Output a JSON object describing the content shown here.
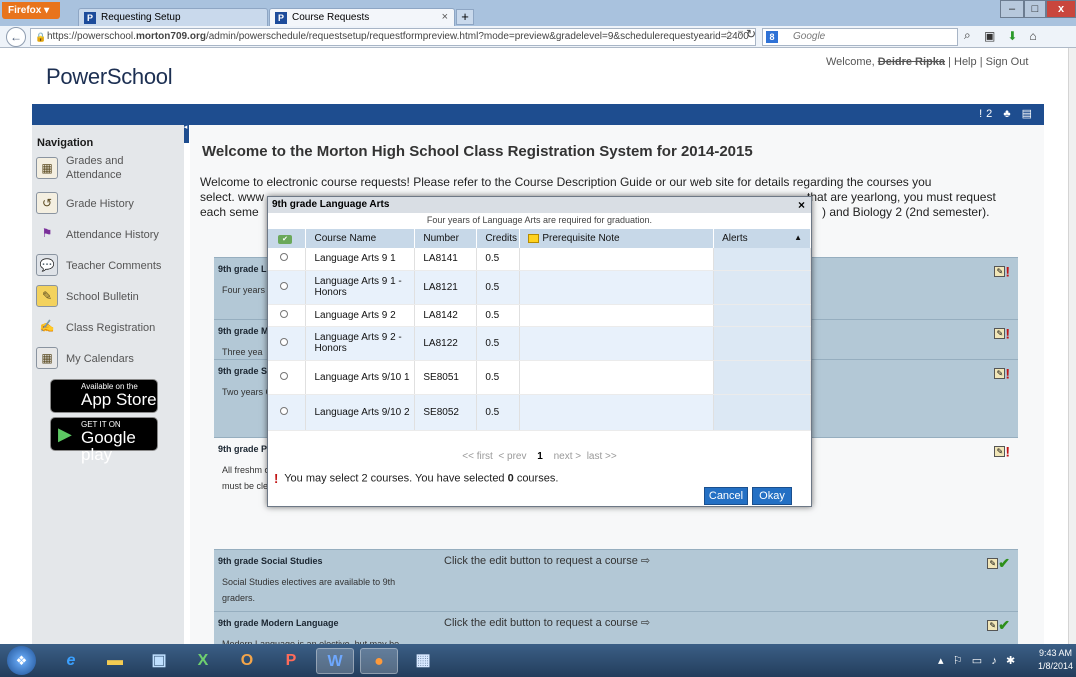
{
  "browser": {
    "menu_button": "Firefox",
    "tabs": [
      {
        "label": "Requesting Setup",
        "active": false
      },
      {
        "label": "Course Requests",
        "active": true
      }
    ],
    "url_prefix": "https://powerschool.",
    "url_domain": "morton709.org",
    "url_path": "/admin/powerschedule/requestsetup/requestformpreview.html?mode=preview&gradelevel=9&schedulerequestyearid=2400",
    "search_placeholder": "Google",
    "new_tab": "+"
  },
  "header": {
    "logo": "PowerSchool",
    "welcome": "Welcome,",
    "user_name": "Deidre Ripka",
    "sep": "|",
    "help": "Help",
    "sign_out": "Sign Out",
    "bar_count": "!2"
  },
  "sidebar": {
    "heading": "Navigation",
    "items": [
      {
        "label": "Grades and Attendance",
        "icon": "gradebook-icon"
      },
      {
        "label": "Grade History",
        "icon": "grade-history-icon"
      },
      {
        "label": "Attendance History",
        "icon": "attendance-icon"
      },
      {
        "label": "Teacher Comments",
        "icon": "comments-icon"
      },
      {
        "label": "School Bulletin",
        "icon": "bulletin-icon"
      },
      {
        "label": "Class Registration",
        "icon": "registration-icon"
      },
      {
        "label": "My Calendars",
        "icon": "calendar-icon"
      }
    ],
    "app_store": {
      "small": "Available on the",
      "big": "App Store"
    },
    "google_play": {
      "small": "GET IT ON",
      "big": "Google play"
    }
  },
  "main": {
    "title": "Welcome to the Morton High School Class Registration System for 2014-2015",
    "intro_1": "Welcome to electronic course requests! Please refer to the Course Description Guide or our web site for details regarding the courses you",
    "intro_2_left": "select. www",
    "intro_2_right": "that are yearlong, you must request",
    "intro_3_left": "each seme",
    "intro_3_right": ") and Biology 2 (2nd semester).",
    "requests": [
      {
        "title": "9th grade L",
        "desc": "Four years graduation",
        "status": "",
        "done": false
      },
      {
        "title": "9th grade M",
        "desc": "Three yea",
        "status": "",
        "done": false
      },
      {
        "title": "9th grade S",
        "desc": "Two years Check col informatio",
        "status": "",
        "done": false
      },
      {
        "title": "9th grade P",
        "desc": "All freshm one seme band, plea medical exemption must be cleared through the Counseling Office.",
        "status": "",
        "done": false
      },
      {
        "title": "9th grade Social Studies",
        "desc": "Social Studies electives are available to 9th graders.",
        "status": "Click the edit button to request a course ⇨",
        "done": true
      },
      {
        "title": "9th grade Modern Language",
        "desc": "Modern Language is an elective, but may be",
        "status": "Click the edit button to request a course ⇨",
        "done": true
      }
    ]
  },
  "dialog": {
    "title": "9th grade Language Arts",
    "close": "×",
    "subtitle": "Four years of Language Arts are required for graduation.",
    "columns": [
      "Course Name",
      "Number",
      "Credits",
      "Prerequisite Note",
      "Alerts"
    ],
    "sort_indicator": "▲",
    "courses": [
      {
        "name": "Language Arts 9 1",
        "number": "LA8141",
        "credits": "0.5"
      },
      {
        "name": "Language Arts 9 1 - Honors",
        "number": "LA8121",
        "credits": "0.5"
      },
      {
        "name": "Language Arts 9 2",
        "number": "LA8142",
        "credits": "0.5"
      },
      {
        "name": "Language Arts 9 2 - Honors",
        "number": "LA8122",
        "credits": "0.5"
      },
      {
        "name": "Language Arts 9/10 1",
        "number": "SE8051",
        "credits": "0.5"
      },
      {
        "name": "Language Arts 9/10 2",
        "number": "SE8052",
        "credits": "0.5"
      }
    ],
    "pager": {
      "first": "<< first",
      "prev": "< prev",
      "current": "1",
      "next": "next >",
      "last": "last >>"
    },
    "message_a": "You may select 2 courses. You have selected",
    "message_count": "0",
    "message_b": "courses.",
    "cancel": "Cancel",
    "okay": "Okay"
  },
  "taskbar": {
    "time": "9:43 AM",
    "date": "1/8/2014"
  }
}
